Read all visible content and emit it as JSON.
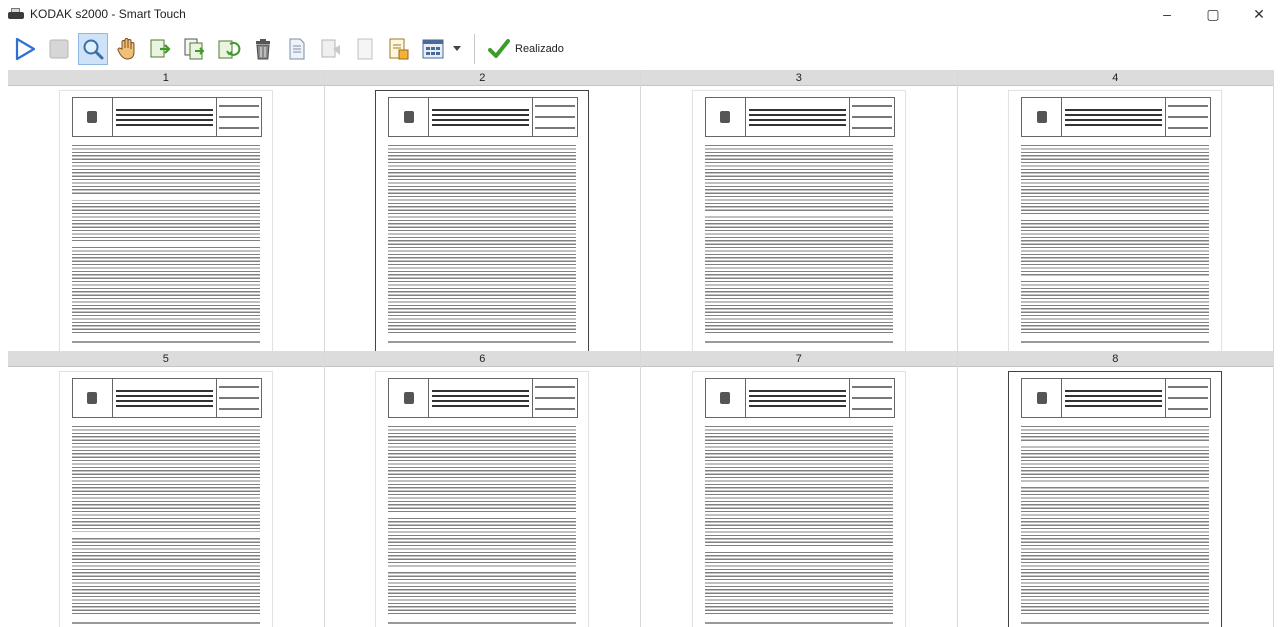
{
  "window": {
    "title": "KODAK s2000 - Smart Touch",
    "controls": [
      "–",
      "▢",
      "✕"
    ]
  },
  "toolbar": {
    "buttons": [
      {
        "icon": "play-icon",
        "tooltip": "Start"
      },
      {
        "icon": "stop-icon",
        "tooltip": "Stop"
      },
      {
        "icon": "zoom-icon",
        "tooltip": "Zoom",
        "active": true
      },
      {
        "icon": "hand-icon",
        "tooltip": "Pan"
      },
      {
        "icon": "move-page-icon",
        "tooltip": "Move"
      },
      {
        "icon": "copy-page-icon",
        "tooltip": "Copy"
      },
      {
        "icon": "rotate-page-icon",
        "tooltip": "Rotate"
      },
      {
        "icon": "delete-icon",
        "tooltip": "Delete"
      },
      {
        "icon": "document-icon",
        "tooltip": "Document"
      },
      {
        "icon": "scan-insert-icon",
        "tooltip": "Insert"
      },
      {
        "icon": "blank-page-icon",
        "tooltip": "Blank"
      },
      {
        "icon": "edit-document-icon",
        "tooltip": "Edit"
      },
      {
        "icon": "layout-grid-icon",
        "tooltip": "Layout"
      }
    ],
    "done_label": "Realizado",
    "accent_color": "#2f6fd6"
  },
  "pages": [
    {
      "number": "1",
      "framed": false
    },
    {
      "number": "2",
      "framed": true
    },
    {
      "number": "3",
      "framed": false
    },
    {
      "number": "4",
      "framed": false
    },
    {
      "number": "5",
      "framed": false
    },
    {
      "number": "6",
      "framed": false
    },
    {
      "number": "7",
      "framed": false
    },
    {
      "number": "8",
      "framed": true
    }
  ]
}
